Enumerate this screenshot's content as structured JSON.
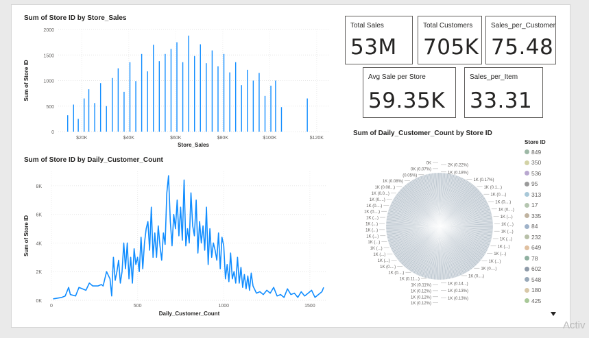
{
  "cards": [
    {
      "label": "Total Sales",
      "value": "53M"
    },
    {
      "label": "Total Customers",
      "value": "705K"
    },
    {
      "label": "Sales_per_Customer",
      "value": "75.48"
    },
    {
      "label": "Avg Sale per Store",
      "value": "59.35K"
    },
    {
      "label": "Sales_per_Item",
      "value": "33.31"
    }
  ],
  "chart_data": [
    {
      "type": "bar",
      "title": "Sum of Store ID by Store_Sales",
      "xlabel": "Store_Sales",
      "ylabel": "Sum of Store ID",
      "ylim": [
        0,
        2000
      ],
      "xlim": [
        10000,
        125000
      ],
      "yticks": [
        0,
        500,
        1000,
        1500,
        2000
      ],
      "yticklabels": [
        "0",
        "500",
        "1000",
        "1500",
        "2000"
      ],
      "xticks": [
        20000,
        40000,
        60000,
        80000,
        100000,
        120000
      ],
      "xticklabels": [
        "$20K",
        "$40K",
        "$60K",
        "$80K",
        "$100K",
        "$120K"
      ],
      "grid": true,
      "color": "#118DFF",
      "x": [
        14000,
        16500,
        18500,
        21000,
        23000,
        25500,
        28000,
        30500,
        33000,
        35500,
        38000,
        40500,
        43000,
        45500,
        48000,
        50500,
        53000,
        55500,
        58000,
        60500,
        63000,
        65500,
        68000,
        70500,
        73000,
        75500,
        78000,
        80500,
        83000,
        85500,
        88000,
        90500,
        93000,
        95500,
        98000,
        100500,
        102500,
        105000,
        116000
      ],
      "values": [
        320,
        530,
        250,
        650,
        830,
        560,
        950,
        500,
        1050,
        1240,
        780,
        1360,
        990,
        1520,
        1180,
        1700,
        1380,
        1520,
        1620,
        1750,
        1360,
        1880,
        1480,
        1710,
        1340,
        1590,
        1280,
        1520,
        1160,
        1360,
        910,
        1210,
        1000,
        1150,
        700,
        900,
        1000,
        480,
        650
      ]
    },
    {
      "type": "line",
      "title": "Sum of Store ID by Daily_Customer_Count",
      "xlabel": "Daily_Customer_Count",
      "ylabel": "Sum of Store ID",
      "ylim": [
        0,
        9000
      ],
      "xlim": [
        0,
        1600
      ],
      "yticks": [
        0,
        2000,
        4000,
        6000,
        8000
      ],
      "yticklabels": [
        "0K",
        "2K",
        "4K",
        "6K",
        "8K"
      ],
      "xticks": [
        0,
        500,
        1000,
        1500
      ],
      "xticklabels": [
        "0",
        "500",
        "1000",
        "1500"
      ],
      "grid": true,
      "color": "#118DFF",
      "x": [
        10,
        60,
        80,
        100,
        110,
        140,
        160,
        180,
        200,
        220,
        240,
        270,
        290,
        300,
        320,
        340,
        350,
        360,
        370,
        380,
        390,
        400,
        410,
        420,
        430,
        440,
        450,
        460,
        470,
        480,
        490,
        500,
        510,
        520,
        530,
        540,
        550,
        560,
        570,
        580,
        590,
        600,
        610,
        620,
        630,
        640,
        650,
        660,
        670,
        680,
        690,
        700,
        710,
        720,
        730,
        740,
        750,
        760,
        770,
        780,
        790,
        800,
        810,
        820,
        830,
        840,
        850,
        860,
        870,
        880,
        890,
        900,
        910,
        920,
        930,
        940,
        950,
        960,
        970,
        980,
        990,
        1000,
        1010,
        1020,
        1030,
        1040,
        1050,
        1060,
        1070,
        1080,
        1090,
        1100,
        1110,
        1120,
        1130,
        1140,
        1150,
        1160,
        1170,
        1190,
        1210,
        1230,
        1250,
        1270,
        1290,
        1310,
        1330,
        1350,
        1370,
        1390,
        1410,
        1430,
        1450,
        1470,
        1490,
        1510,
        1530,
        1550,
        1570,
        1580
      ],
      "values": [
        100,
        200,
        300,
        900,
        400,
        300,
        900,
        800,
        700,
        1200,
        1000,
        1000,
        1100,
        1000,
        2000,
        1500,
        300,
        3000,
        1400,
        2000,
        2800,
        1200,
        2000,
        4000,
        2200,
        4000,
        1500,
        3000,
        1200,
        3600,
        2500,
        3000,
        2000,
        4400,
        2200,
        4000,
        5000,
        5500,
        3500,
        6500,
        3000,
        4700,
        3000,
        5200,
        3800,
        2800,
        4700,
        3900,
        7500,
        8700,
        5500,
        3800,
        6000,
        5000,
        7000,
        4500,
        6500,
        4200,
        8400,
        3800,
        5000,
        4000,
        7500,
        5200,
        4500,
        7000,
        3300,
        5500,
        4000,
        5200,
        3500,
        6500,
        2500,
        5000,
        3000,
        4000,
        3500,
        2800,
        4700,
        2200,
        4400,
        3800,
        1500,
        2500,
        1300,
        3300,
        1500,
        2000,
        1200,
        3000,
        1200,
        2300,
        900,
        1800,
        800,
        1700,
        700,
        1900,
        1000,
        500,
        600,
        400,
        700,
        500,
        900,
        300,
        400,
        200,
        800,
        400,
        500,
        200,
        600,
        300,
        500,
        700,
        200,
        400,
        600,
        900
      ]
    },
    {
      "type": "pie",
      "title": "Sum of Daily_Customer_Count by Store ID",
      "legend_title": "Store ID",
      "legend_position": "right",
      "legend": [
        "849",
        "350",
        "536",
        "95",
        "313",
        "17",
        "335",
        "84",
        "232",
        "649",
        "78",
        "602",
        "548",
        "180",
        "425"
      ],
      "legend_colors": [
        "#9db8a6",
        "#d3d3a6",
        "#b9a8d0",
        "#9a9a9a",
        "#a8c8d8",
        "#b5c6b0",
        "#c0b3a0",
        "#9fb2c9",
        "#b8c0a8",
        "#e0c0a0",
        "#8fb0a0",
        "#8e9aa8",
        "#98a8b8",
        "#d8c8a8",
        "#a8c898"
      ],
      "data_labels_left": [
        "0K",
        "0K (0.07%)",
        "(0.05%)",
        "1K (0.08%)",
        "1K (0.08...)",
        "1K (0.0...)",
        "1K (0....)",
        "1K (0....)",
        "1K (0....)",
        "1K (...)",
        "1K (...)",
        "1K (...)",
        "1K (...)",
        "1K (...)",
        "1K (...)",
        "1K (...)",
        "1K (...)",
        "1K (0....)",
        "1K (0....)",
        "1K (0.11...)",
        "1K (0.11%)",
        "1K (0.12%)",
        "1K (0.12%)",
        "1K (0.12%)"
      ],
      "data_labels_right": [
        "2K (0.22%)",
        "1K (0.18%)",
        "1K (0.17%)",
        "1K (0.1...)",
        "1K (0....)",
        "1K (0....)",
        "1K (0....)",
        "1K (...)",
        "1K (...)",
        "1K (...)",
        "1K (...)",
        "1K (...)",
        "1K (...)",
        "1K (...)",
        "1K (0....)",
        "1K (0....)",
        "1K (0.14...)",
        "1K (0.13%)",
        "1K (0.13%)"
      ]
    }
  ],
  "watermark": "Activ"
}
